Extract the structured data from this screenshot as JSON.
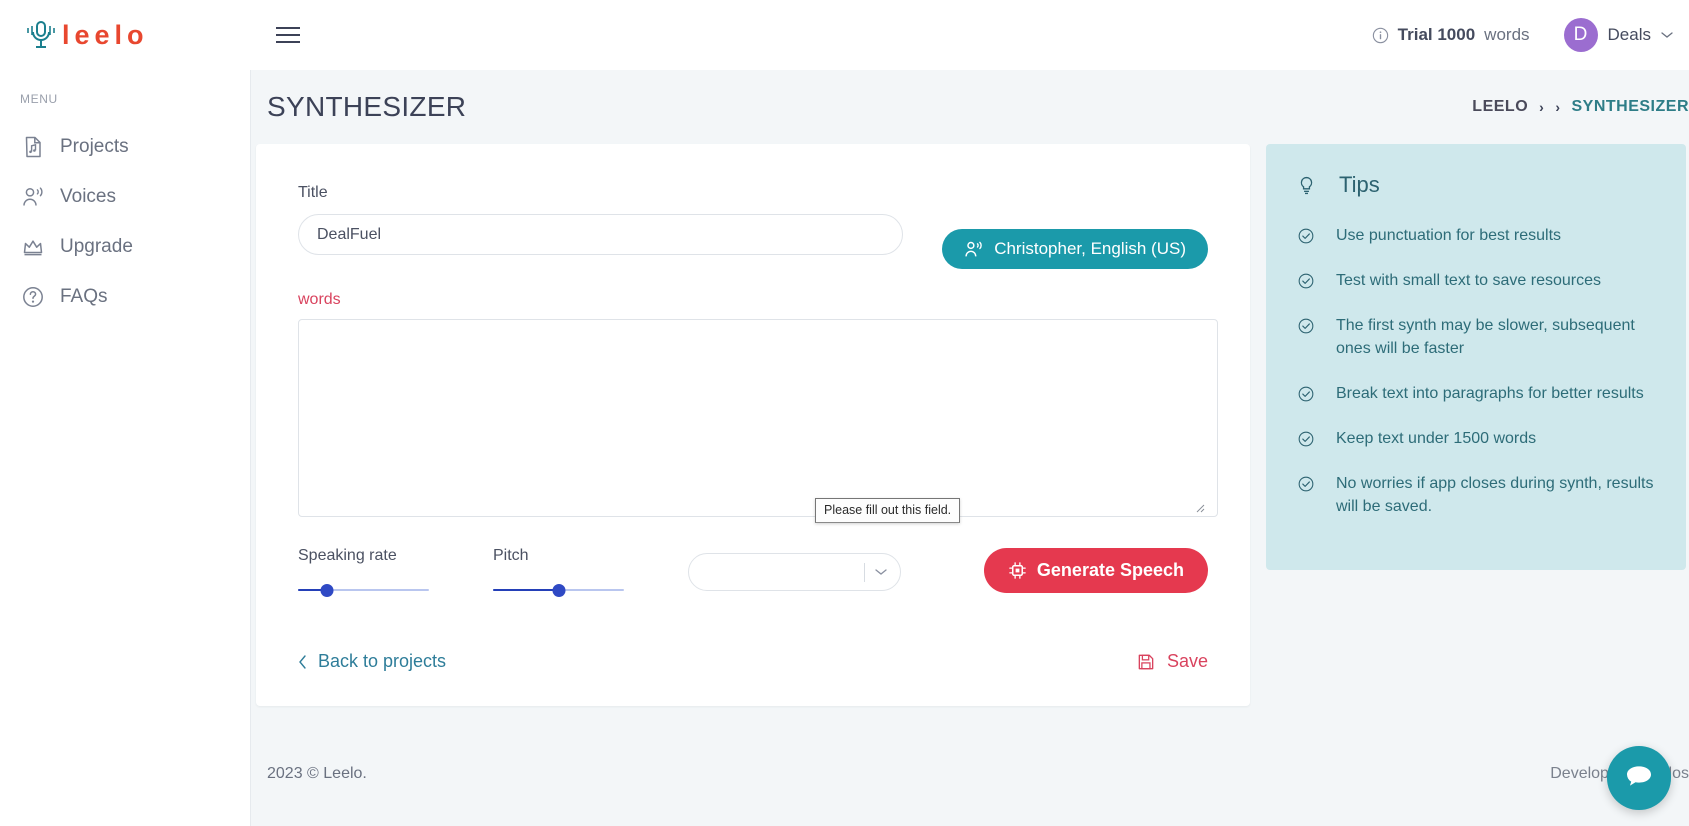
{
  "topbar": {
    "logo_text": "leelo",
    "logo_icon": "microphone-icon",
    "menu_icon": "hamburger-menu-icon",
    "trial": {
      "info_icon": "info-circle-icon",
      "plan": "Trial 1000",
      "unit": "words"
    },
    "profile": {
      "avatar_initial": "D",
      "name": "Deals",
      "chevron_icon": "chevron-down-icon"
    }
  },
  "sidebar": {
    "section_label": "MENU",
    "items": [
      {
        "label": "Projects",
        "icon": "file-music-icon"
      },
      {
        "label": "Voices",
        "icon": "person-voice-icon"
      },
      {
        "label": "Upgrade",
        "icon": "crown-icon"
      },
      {
        "label": "FAQs",
        "icon": "question-circle-icon"
      }
    ]
  },
  "page": {
    "title": "SYNTHESIZER",
    "breadcrumb": {
      "root": "LEELO",
      "separator": "›",
      "current": "SYNTHESIZER"
    }
  },
  "form": {
    "title_label": "Title",
    "title_value": "DealFuel",
    "title_placeholder": "Title",
    "voice_button": {
      "label": "Christopher, English (US)",
      "icon": "person-voice-icon"
    },
    "words_label": "words",
    "text_value": "",
    "text_placeholder": "",
    "validation_tooltip": "Please fill out this field.",
    "speaking_rate": {
      "label": "Speaking rate",
      "value_percent": 22
    },
    "pitch": {
      "label": "Pitch",
      "value_percent": 50
    },
    "language_select": {
      "value": "",
      "chevron_icon": "chevron-down-icon"
    },
    "generate_button": {
      "label": "Generate Speech",
      "icon": "chip-icon",
      "color": "#e5394f"
    },
    "back_link": {
      "label": "Back to projects",
      "icon": "chevron-left-icon"
    },
    "save_link": {
      "label": "Save",
      "icon": "save-icon"
    }
  },
  "tips": {
    "title": "Tips",
    "icon": "lightbulb-icon",
    "bullet_icon": "check-circle-icon",
    "background": "#cfe8ec",
    "items": [
      "Use punctuation for best results",
      "Test with small text to save resources",
      "The first synth may be slower, subsequent ones will be faster",
      "Break text into paragraphs for better results",
      "Keep text under 1500 words",
      "No worries if app closes during synth, results will be saved."
    ]
  },
  "footer": {
    "copyright": "2023 © Leelo.",
    "developed_by": "Developed by …los"
  },
  "chat": {
    "icon": "chat-bubble-icon",
    "color": "#1b9aaa"
  }
}
